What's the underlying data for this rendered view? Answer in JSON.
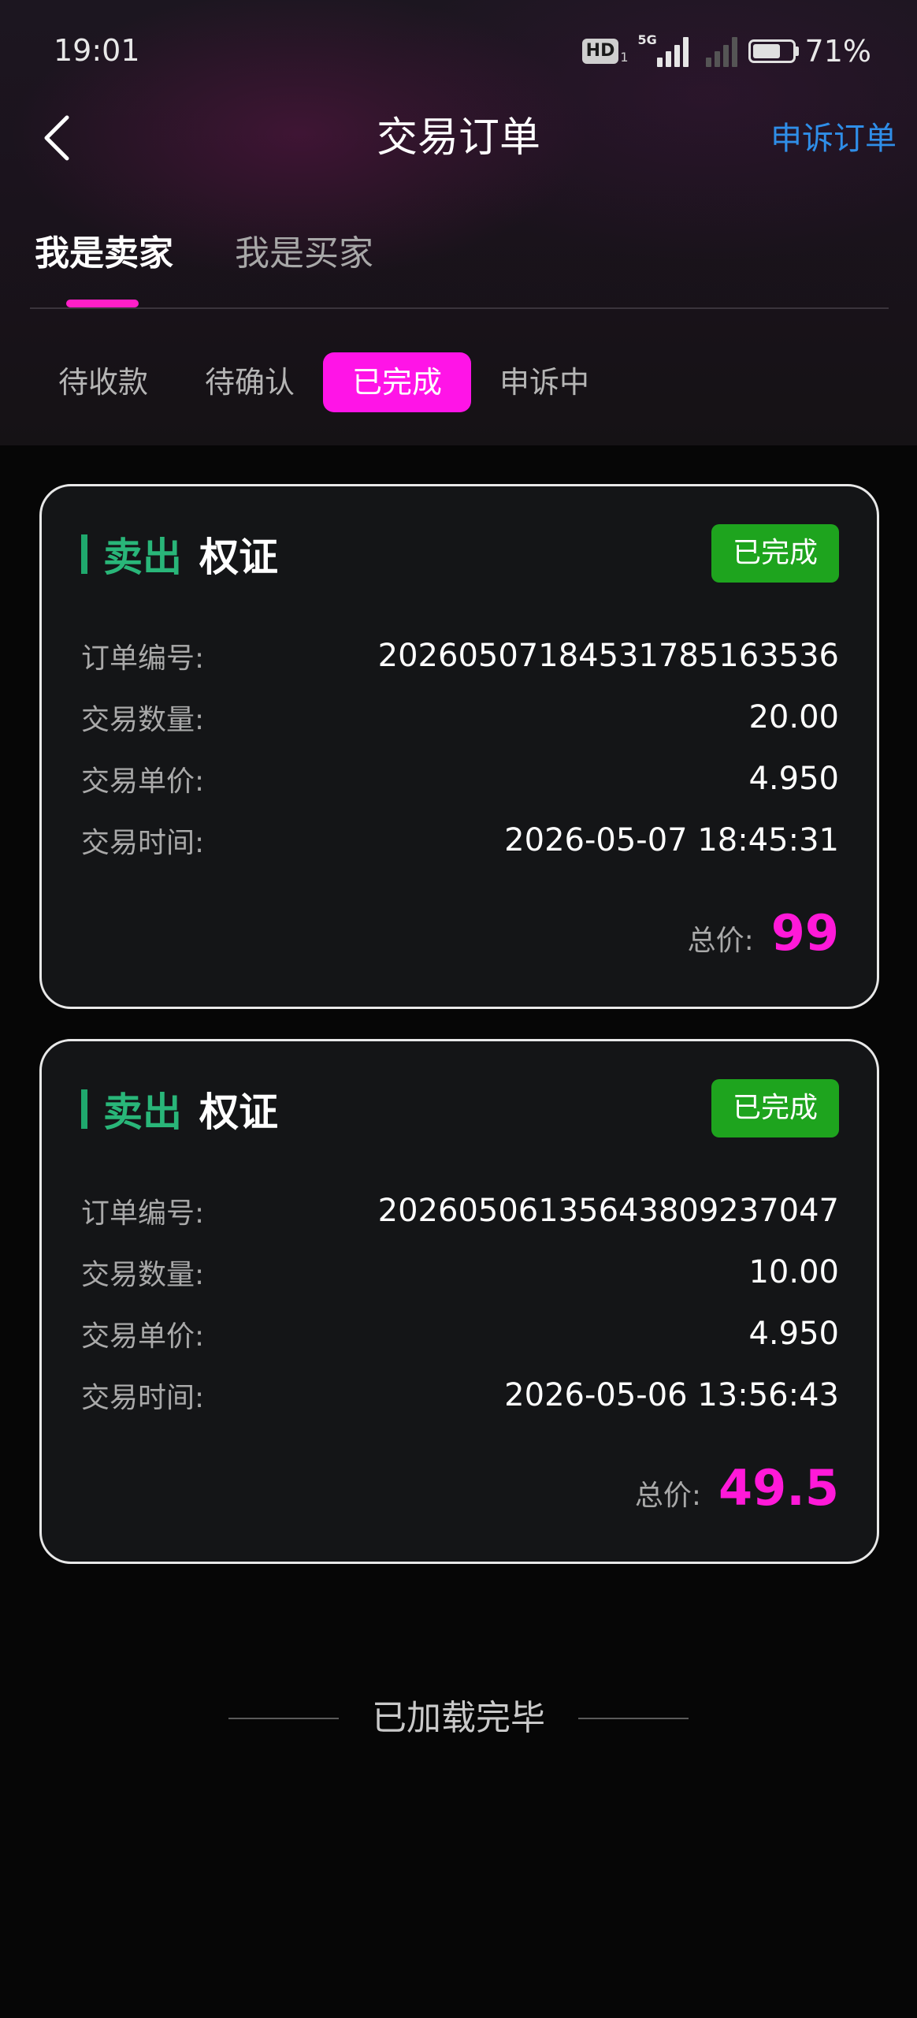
{
  "status_bar": {
    "time": "19:01",
    "hd_label": "HD",
    "hd_sub": "1",
    "network_label": "5G",
    "battery_percent": "71%",
    "battery_level": 0.71
  },
  "nav": {
    "back_icon": "chevron-left-icon",
    "title": "交易订单",
    "appeal_link": "申诉订单"
  },
  "role_tabs": [
    {
      "label": "我是卖家",
      "active": true
    },
    {
      "label": "我是买家",
      "active": false
    }
  ],
  "status_filters": [
    {
      "label": "待收款",
      "active": false
    },
    {
      "label": "待确认",
      "active": false
    },
    {
      "label": "已完成",
      "active": true
    },
    {
      "label": "申诉中",
      "active": false
    }
  ],
  "colors": {
    "accent_pink": "#ff14e7",
    "sell_green": "#29b679",
    "badge_green": "#1ea41e",
    "link_blue": "#2f8ee8",
    "total_pink": "#ff19d8"
  },
  "orders": [
    {
      "side": "卖出",
      "asset": "权证",
      "status": "已完成",
      "fields": [
        {
          "label": "订单编号:",
          "value": "202605071845317851635​36"
        },
        {
          "label": "交易数量:",
          "value": "20.00"
        },
        {
          "label": "交易单价:",
          "value": "4.950"
        },
        {
          "label": "交易时间:",
          "value": "2026-05-07 18:45:31"
        }
      ],
      "total_label": "总价:",
      "total_value": "99"
    },
    {
      "side": "卖出",
      "asset": "权证",
      "status": "已完成",
      "fields": [
        {
          "label": "订单编号:",
          "value": "20260506135643809237047"
        },
        {
          "label": "交易数量:",
          "value": "10.00"
        },
        {
          "label": "交易单价:",
          "value": "4.950"
        },
        {
          "label": "交易时间:",
          "value": "2026-05-06 13:56:43"
        }
      ],
      "total_label": "总价:",
      "total_value": "49.5"
    }
  ],
  "footer": {
    "end_text": "已加载完毕"
  }
}
